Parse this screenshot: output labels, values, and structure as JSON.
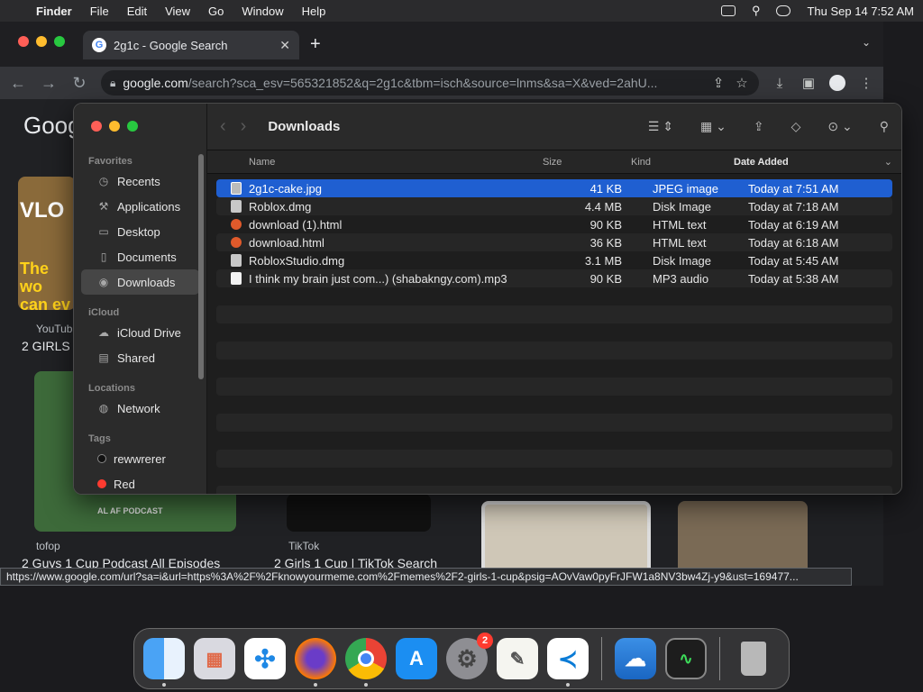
{
  "menubar": {
    "items": [
      "Finder",
      "File",
      "Edit",
      "View",
      "Go",
      "Window",
      "Help"
    ],
    "clock": "Thu Sep 14  7:52 AM"
  },
  "chrome": {
    "tab_title": "2g1c - Google Search",
    "url_host": "google.com",
    "url_path": "/search?sca_esv=565321852&q=2g1c&tbm=isch&source=lnms&sa=X&ved=2ahU...",
    "status_url": "https://www.google.com/url?sa=i&url=https%3A%2F%2Fknowyourmeme.com%2Fmemes%2F2-girls-1-cup&psig=AOvVaw0pyFrJFW1a8NV3bw4Zj-y9&ust=169477...",
    "results": [
      {
        "source": "YouTub",
        "caption": "2 GIRLS "
      },
      {
        "source": "tofop",
        "caption": "2 Guys 1 Cup Podcast All Episodes"
      },
      {
        "source": "TikTok",
        "caption": "2 Girls 1 Cup | TikTok Search"
      }
    ],
    "thumb_text": {
      "vlog": "VLO",
      "overlay": "The wo can ev",
      "podcast": "AL AF PODCAST"
    }
  },
  "finder": {
    "title": "Downloads",
    "sidebar": {
      "favorites_label": "Favorites",
      "favorites": [
        "Recents",
        "Applications",
        "Desktop",
        "Documents",
        "Downloads"
      ],
      "icloud_label": "iCloud",
      "icloud": [
        "iCloud Drive",
        "Shared"
      ],
      "locations_label": "Locations",
      "locations": [
        "Network"
      ],
      "tags_label": "Tags",
      "tags": [
        "rewwrerer",
        "Red"
      ]
    },
    "columns": {
      "name": "Name",
      "size": "Size",
      "kind": "Kind",
      "date": "Date Added"
    },
    "files": [
      {
        "name": "2g1c-cake.jpg",
        "size": "41 KB",
        "kind": "JPEG image",
        "date": "Today at 7:51 AM",
        "selected": true
      },
      {
        "name": "Roblox.dmg",
        "size": "4.4 MB",
        "kind": "Disk Image",
        "date": "Today at 7:18 AM"
      },
      {
        "name": "download (1).html",
        "size": "90 KB",
        "kind": "HTML text",
        "date": "Today at 6:19 AM"
      },
      {
        "name": "download.html",
        "size": "36 KB",
        "kind": "HTML text",
        "date": "Today at 6:18 AM"
      },
      {
        "name": "RobloxStudio.dmg",
        "size": "3.1 MB",
        "kind": "Disk Image",
        "date": "Today at 5:45 AM"
      },
      {
        "name": "I think my brain just com...) (shabakngy.com).mp3",
        "size": "90 KB",
        "kind": "MP3 audio",
        "date": "Today at 5:38 AM"
      }
    ]
  },
  "dock": {
    "settings_badge": "2"
  }
}
